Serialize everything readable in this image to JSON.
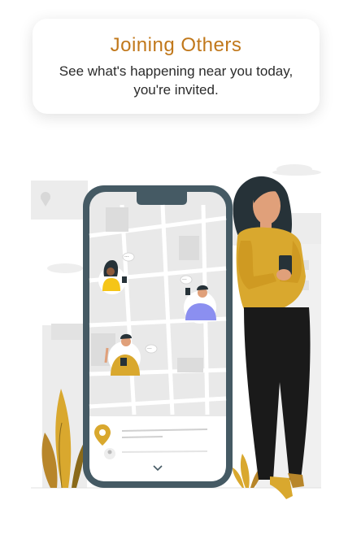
{
  "onboarding": {
    "title": "Joining Others",
    "subtitle": "See what's happening near you today, you're invited."
  },
  "colors": {
    "accent": "#c1781b",
    "mustard": "#d9a82e",
    "phone_frame": "#455a64",
    "map_bg": "#e6e6e6"
  },
  "icons": [
    "location-pin-icon",
    "user-icon",
    "chevron-down-icon",
    "chat-bubble-icon"
  ]
}
